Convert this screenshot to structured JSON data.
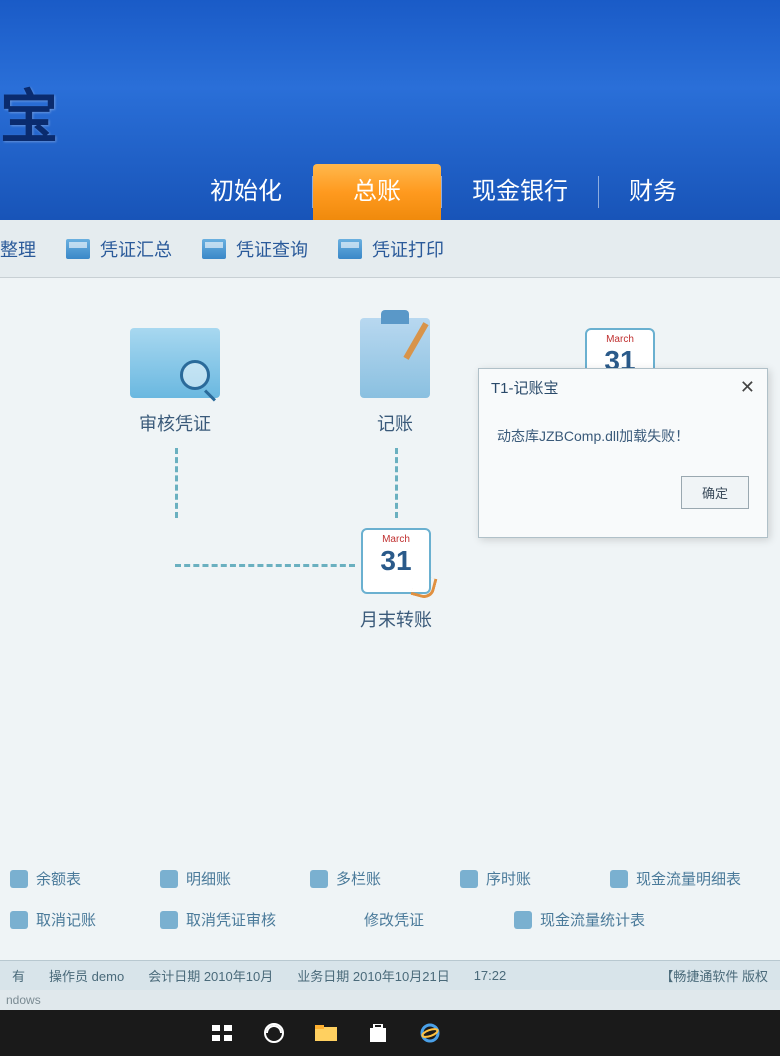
{
  "header": {
    "title_fragment": "宝"
  },
  "nav": {
    "items": [
      "初始化",
      "总账",
      "现金银行",
      "财务"
    ],
    "active_index": 1
  },
  "toolbar": {
    "items": [
      "整理",
      "凭证汇总",
      "凭证查询",
      "凭证打印"
    ]
  },
  "flow": {
    "audit": "审核凭证",
    "book": "记账",
    "monthend": "月末转账",
    "cal_month": "March",
    "cal_day": "31"
  },
  "dialog": {
    "title": "T1-记账宝",
    "message": "动态库JZBComp.dll加载失败！",
    "ok": "确定"
  },
  "links_row1": [
    "余额表",
    "明细账",
    "多栏账",
    "序时账",
    "现金流量明细表"
  ],
  "links_row2": [
    "取消记账",
    "取消凭证审核",
    "修改凭证",
    "现金流量统计表"
  ],
  "status": {
    "left_prefix": "有",
    "operator_label": "操作员",
    "operator": "demo",
    "acct_date_label": "会计日期",
    "acct_date": "2010年10月",
    "biz_date_label": "业务日期",
    "biz_date": "2010年10月21日",
    "time": "17:22",
    "right": "【畅捷通软件 版权"
  },
  "os_label": "ndows"
}
